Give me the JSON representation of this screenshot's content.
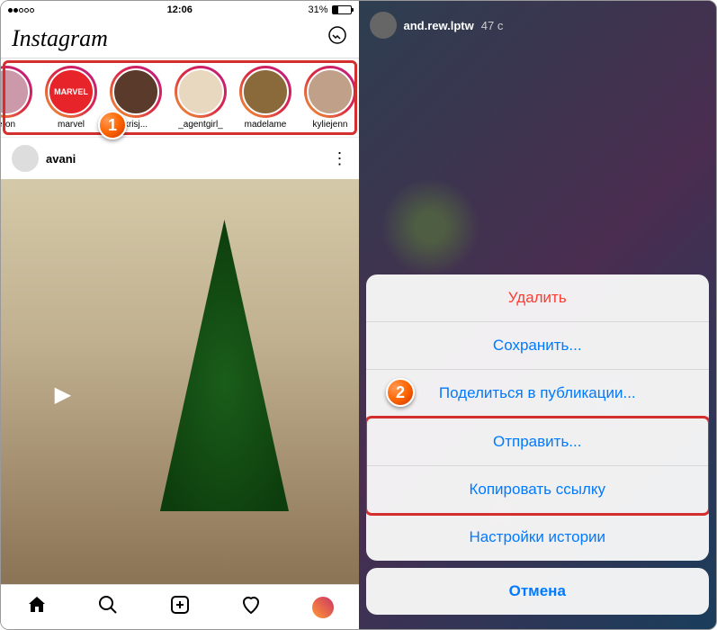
{
  "statusBar": {
    "time": "12:06",
    "battery": "31%"
  },
  "header": {
    "logo": "Instagram"
  },
  "stories": [
    {
      "label": "eron"
    },
    {
      "label": "marvel"
    },
    {
      "label": "krisj..."
    },
    {
      "label": "_agentgirl_"
    },
    {
      "label": "madelame"
    },
    {
      "label": "kyliejenn"
    }
  ],
  "post": {
    "username": "avani"
  },
  "storyView": {
    "username": "and.rew.lptw",
    "time": "47 с"
  },
  "actionSheet": {
    "delete": "Удалить",
    "save": "Сохранить...",
    "shareToPost": "Поделиться в публикации...",
    "send": "Отправить...",
    "copyLink": "Копировать ссылку",
    "storySettings": "Настройки истории",
    "cancel": "Отмена"
  },
  "badges": {
    "one": "1",
    "two": "2"
  }
}
